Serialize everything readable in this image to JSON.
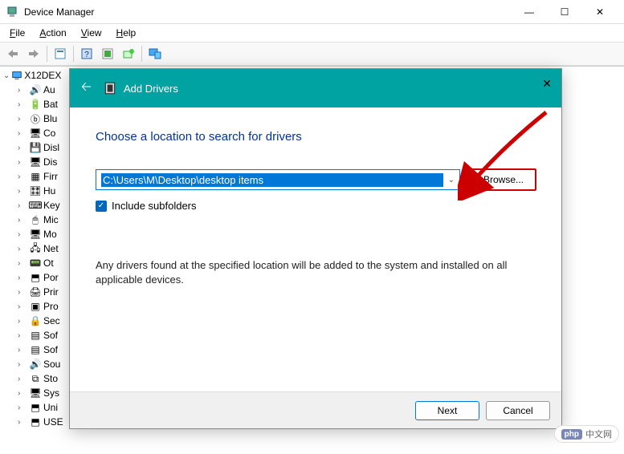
{
  "window": {
    "title": "Device Manager",
    "controls": {
      "min": "—",
      "max": "☐",
      "close": "✕"
    }
  },
  "menu": {
    "file": "File",
    "action": "Action",
    "view": "View",
    "help": "Help"
  },
  "tree": {
    "root": "X12DEX",
    "items": [
      {
        "label": "Au",
        "icon": "🔊"
      },
      {
        "label": "Bat",
        "icon": "🔋"
      },
      {
        "label": "Blu",
        "icon": "ⓑ"
      },
      {
        "label": "Co",
        "icon": "🖥"
      },
      {
        "label": "Disl",
        "icon": "💾"
      },
      {
        "label": "Dis",
        "icon": "🖥"
      },
      {
        "label": "Firr",
        "icon": "▦"
      },
      {
        "label": "Hu",
        "icon": "🎛"
      },
      {
        "label": "Key",
        "icon": "⌨"
      },
      {
        "label": "Mic",
        "icon": "🖱"
      },
      {
        "label": "Mo",
        "icon": "🖥"
      },
      {
        "label": "Net",
        "icon": "🖧"
      },
      {
        "label": "Ot",
        "icon": "📟"
      },
      {
        "label": "Por",
        "icon": "⬒"
      },
      {
        "label": "Prir",
        "icon": "🖨"
      },
      {
        "label": "Pro",
        "icon": "▣"
      },
      {
        "label": "Sec",
        "icon": "🔒"
      },
      {
        "label": "Sof",
        "icon": "▤"
      },
      {
        "label": "Sof",
        "icon": "▤"
      },
      {
        "label": "Sou",
        "icon": "🔊"
      },
      {
        "label": "Sto",
        "icon": "⧉"
      },
      {
        "label": "Sys",
        "icon": "🖥"
      },
      {
        "label": "Uni",
        "icon": "⬒"
      },
      {
        "label": "USE",
        "icon": "⬒"
      }
    ]
  },
  "dialog": {
    "title": "Add Drivers",
    "heading": "Choose a location to search for drivers",
    "path": "C:\\Users\\M\\Desktop\\desktop items",
    "browse_label": "Browse...",
    "checkbox_label": "Include subfolders",
    "info_text": "Any drivers found at the specified location will be added to the system and installed on all applicable devices.",
    "next_label": "Next",
    "cancel_label": "Cancel"
  },
  "watermark": {
    "badge": "php",
    "text": "中文网"
  }
}
